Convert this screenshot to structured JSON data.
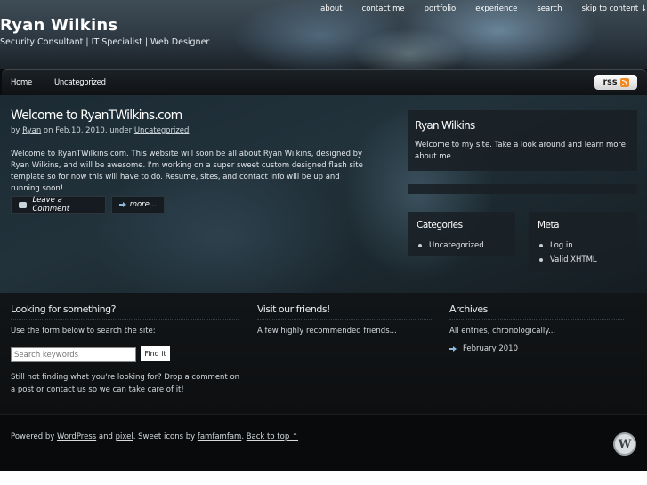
{
  "header": {
    "site_title": "Ryan Wilkins",
    "site_description": "Security Consultant | IT Specialist | Web Designer",
    "top_nav": [
      "about",
      "contact me",
      "portfolio",
      "experience",
      "search",
      "skip to content ↓"
    ]
  },
  "nav": {
    "home": "Home",
    "uncategorized": "Uncategorized",
    "rss_label": "rss",
    "rss_icon": "rss-feed-icon"
  },
  "post": {
    "title": "Welcome to RyanTWilkins.com",
    "meta_by": "by",
    "meta_author": "Ryan",
    "meta_date": "on Feb.10, 2010, under",
    "meta_category": "Uncategorized",
    "body": "Welcome to RyanTWilkins.com.  This website will soon be all about Ryan Wilkins, designed by Ryan Wilkins, and will be awesome.  I'm working on a super sweet custom designed flash site template so for now this will have to do.  Resume, sites, and contact info will be up and running soon!",
    "leave_comment": "Leave a Comment",
    "more": "more..."
  },
  "sidebar": {
    "about_title": "Ryan Wilkins",
    "about_text": "Welcome to my site. Take a look around and learn more about me",
    "categories_title": "Categories",
    "categories": [
      "Uncategorized"
    ],
    "meta_title": "Meta",
    "meta_links": [
      "Log in",
      "Valid XHTML"
    ]
  },
  "lower": {
    "search_title": "Looking for something?",
    "search_text": "Use the form below to search the site:",
    "search_placeholder": "Search keywords",
    "find_label": "Find it",
    "search_footer": "Still not finding what you're looking for? Drop a comment on a post or contact us so we can take care of it!",
    "friends_title": "Visit our friends!",
    "friends_text": "A few highly recommended friends...",
    "archives_title": "Archives",
    "archives_text": "All entries, chronologically...",
    "archives": [
      "February 2010"
    ]
  },
  "footer": {
    "powered_by": "Powered by",
    "wordpress": "WordPress",
    "and": "and",
    "pixel": "pixel",
    "icons_text": ". Sweet icons by",
    "famfamfam": "famfamfam",
    "back_to_top": "Back to top ↑"
  }
}
